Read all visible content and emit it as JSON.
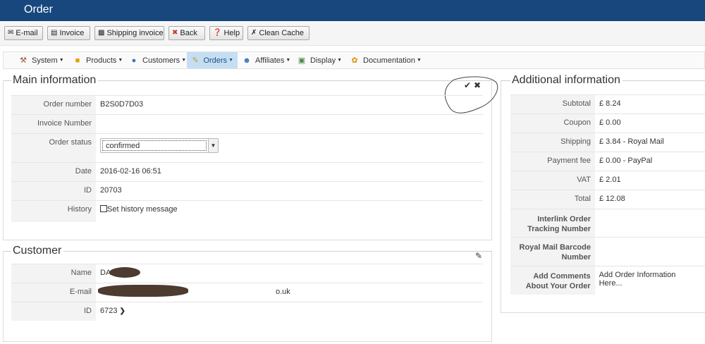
{
  "header": {
    "title": "Order"
  },
  "toolbar": {
    "buttons": [
      {
        "label": "E-mail",
        "icon": "envelope-icon"
      },
      {
        "label": "Invoice",
        "icon": "invoice-icon"
      },
      {
        "label": "Shipping invoice",
        "icon": "truck-icon"
      },
      {
        "label": "Back",
        "icon": "back-icon"
      },
      {
        "label": "Help",
        "icon": "help-icon"
      },
      {
        "label": "Clean Cache",
        "icon": "clean-icon"
      }
    ]
  },
  "menu": {
    "items": [
      {
        "label": "System",
        "icon": "tools-icon"
      },
      {
        "label": "Products",
        "icon": "products-icon"
      },
      {
        "label": "Customers",
        "icon": "customers-icon"
      },
      {
        "label": "Orders",
        "icon": "orders-icon",
        "active": true
      },
      {
        "label": "Affiliates",
        "icon": "affiliates-icon"
      },
      {
        "label": "Display",
        "icon": "display-icon"
      },
      {
        "label": "Documentation",
        "icon": "documentation-icon"
      }
    ]
  },
  "main_info": {
    "title": "Main information",
    "rows": {
      "order_number": {
        "label": "Order number",
        "value": "B2S0D7D03"
      },
      "invoice_number": {
        "label": "Invoice Number",
        "value": ""
      },
      "order_status": {
        "label": "Order status",
        "value": "confirmed"
      },
      "date": {
        "label": "Date",
        "value": "2016-02-16 06:51"
      },
      "id": {
        "label": "ID",
        "value": "20703"
      },
      "history": {
        "label": "History",
        "value": "Set history message"
      }
    }
  },
  "customer": {
    "title": "Customer",
    "rows": {
      "name": {
        "label": "Name",
        "value": "DA"
      },
      "email": {
        "label": "E-mail",
        "value": "o.uk"
      },
      "id": {
        "label": "ID",
        "value": "6723"
      }
    }
  },
  "additional": {
    "title": "Additional information",
    "rows": [
      {
        "label": "Subtotal",
        "value": "£ 8.24"
      },
      {
        "label": "Coupon",
        "value": "£ 0.00"
      },
      {
        "label": "Shipping",
        "value": "£ 3.84 - Royal Mail"
      },
      {
        "label": "Payment fee",
        "value": "£ 0.00 - PayPal"
      },
      {
        "label": "VAT",
        "value": "£ 2.01"
      },
      {
        "label": "Total",
        "value": "£ 12.08"
      },
      {
        "label": "Interlink Order Tracking Number",
        "value": ""
      },
      {
        "label": "Royal Mail Barcode Number",
        "value": ""
      },
      {
        "label": "Add Comments About Your Order",
        "value": "Add Order Information Here..."
      }
    ]
  }
}
